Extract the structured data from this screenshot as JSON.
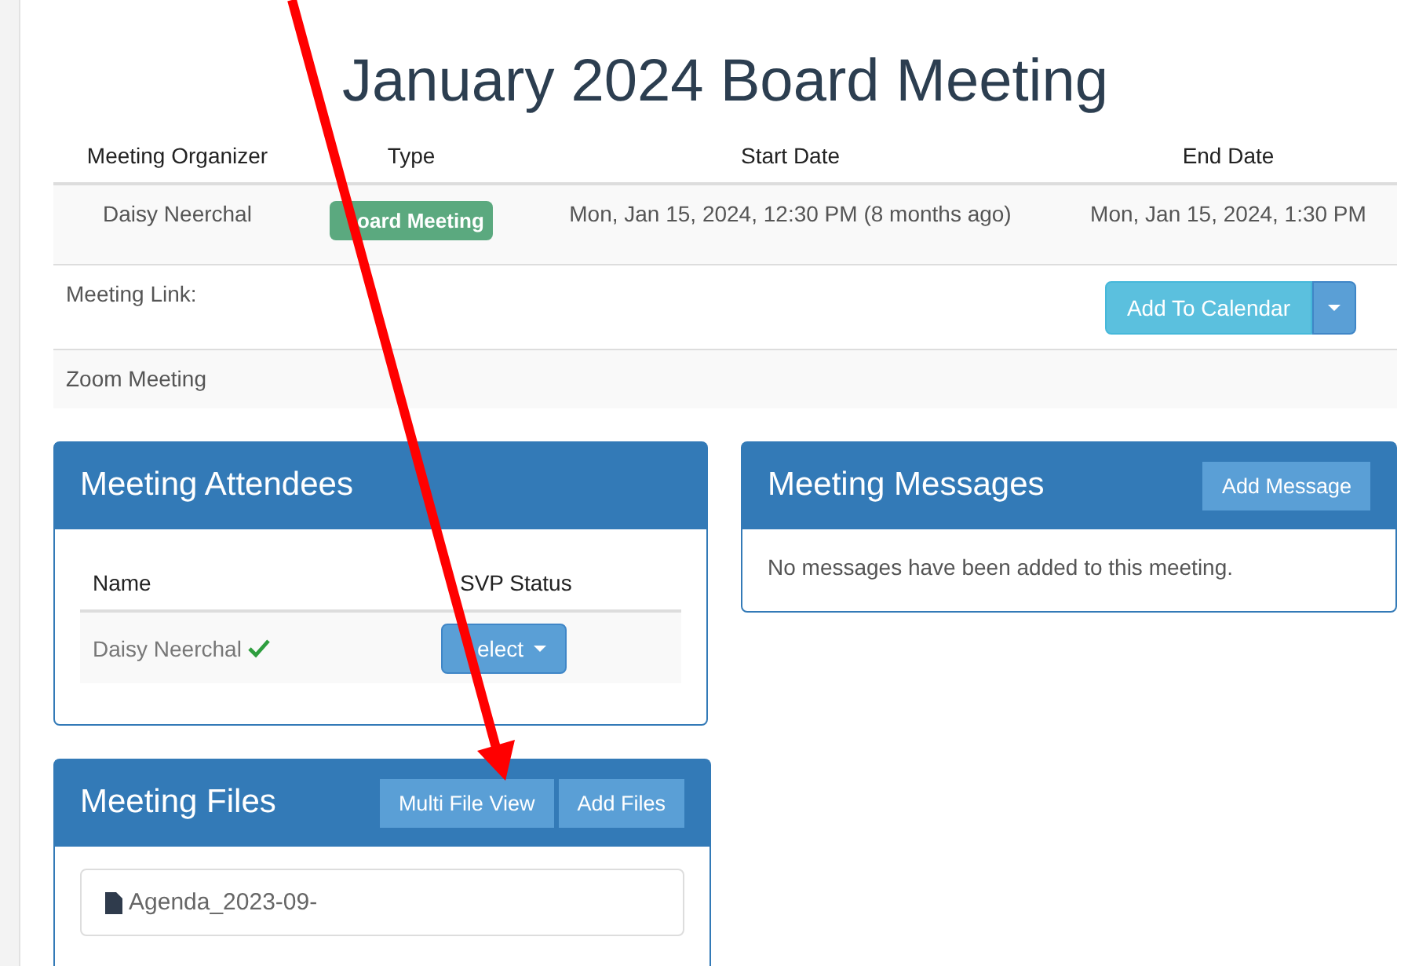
{
  "title": "January 2024 Board Meeting",
  "details": {
    "columns": [
      "Meeting Organizer",
      "Type",
      "Start Date",
      "End Date"
    ],
    "organizer": "Daisy Neerchal",
    "type": "oard Meeting",
    "start": "Mon, Jan 15, 2024, 12:30 PM (8 months ago)",
    "end": "Mon, Jan 15, 2024, 1:30 PM"
  },
  "meeting_link": {
    "label": "Meeting Link:",
    "calendar_button": "Add To Calendar"
  },
  "location": "Zoom Meeting",
  "attendees": {
    "title": "Meeting Attendees",
    "columns": [
      "Name",
      "SVP Status"
    ],
    "rows": [
      {
        "name": "Daisy Neerchal",
        "confirmed": true,
        "rsvp": "elect"
      }
    ]
  },
  "messages": {
    "title": "Meeting Messages",
    "button": "Add Message",
    "empty": "No messages have been added to this meeting."
  },
  "files": {
    "title": "Meeting Files",
    "buttons": [
      "Multi File View",
      "Add Files"
    ],
    "items": [
      "Agenda_2023-09-"
    ]
  }
}
